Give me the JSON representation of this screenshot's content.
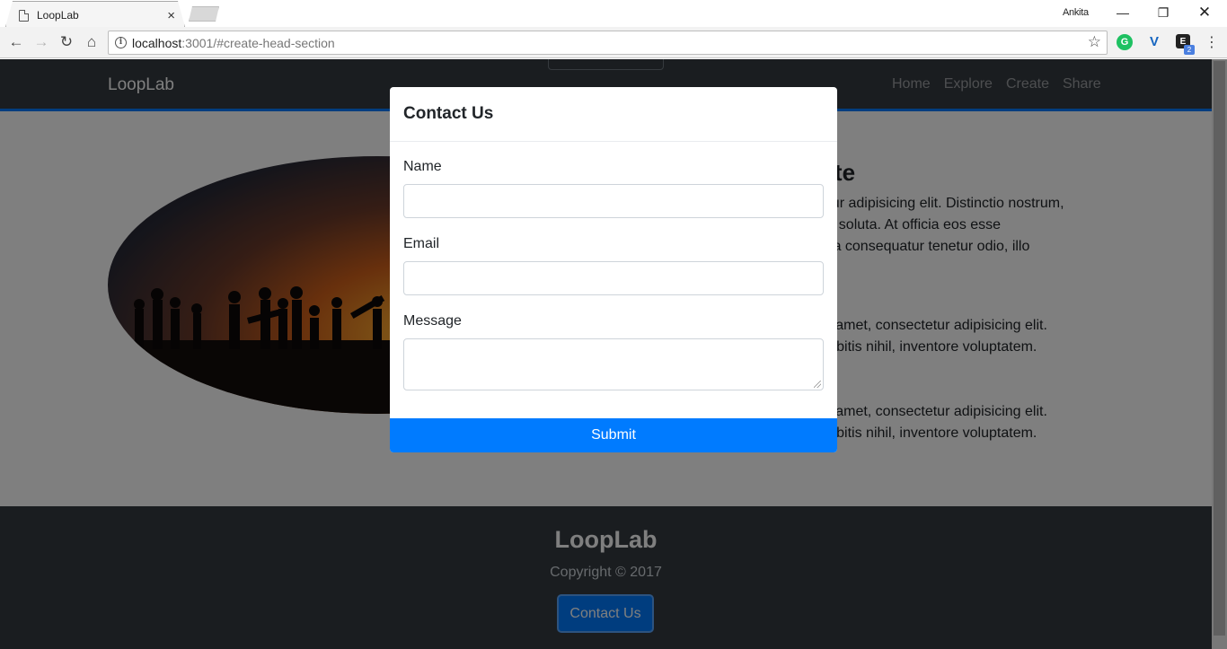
{
  "browser": {
    "tab_title": "LoopLab",
    "tab_close": "×",
    "user_name": "Ankita",
    "url_host": "localhost",
    "url_rest": ":3001/#create-head-section",
    "controls": {
      "minimize": "—",
      "maximize": "❐",
      "close": "✕"
    }
  },
  "navbar": {
    "brand": "LoopLab",
    "links": [
      "Home",
      "Explore",
      "Create",
      "Share"
    ]
  },
  "page": {
    "heading_partial": "eate",
    "paragraphs": [
      [
        "ctetur adipisicing elit. Distinctio nostrum,",
        "uasi soluta. At officia eos esse",
        "ollitia consequatur tenetur odio, illo"
      ],
      [
        "r sit amet, consectetur adipisicing elit.",
        "a debitis nihil, inventore voluptatem."
      ],
      [
        "r sit amet, consectetur adipisicing elit.",
        "a debitis nihil, inventore voluptatem."
      ]
    ]
  },
  "footer": {
    "brand": "LoopLab",
    "copyright": "Copyright © 2017",
    "contact_button": "Contact Us"
  },
  "modal": {
    "title": "Contact Us",
    "fields": [
      {
        "label": "Name",
        "value": ""
      },
      {
        "label": "Email",
        "value": ""
      },
      {
        "label": "Message",
        "value": ""
      }
    ],
    "submit_label": "Submit"
  },
  "colors": {
    "primary": "#007bff",
    "navbar_bg": "#343a40",
    "backdrop": "rgba(0,0,0,0.5)"
  }
}
